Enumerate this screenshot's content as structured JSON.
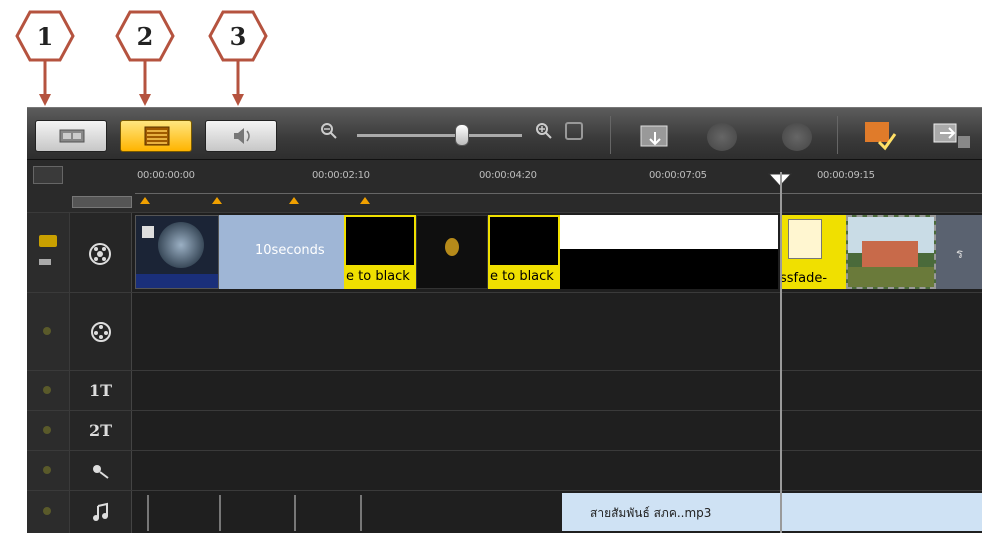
{
  "callouts": [
    "1",
    "2",
    "3"
  ],
  "view_buttons": {
    "storyboard": "storyboard-view-button",
    "timeline": "timeline-view-button",
    "audio": "audio-view-button"
  },
  "toolbar": {
    "zoom_out_icon": "zoom-out-icon",
    "zoom_in_icon": "zoom-in-icon",
    "fit_icon": "fit-to-window-icon",
    "insert_media_icon": "insert-media-icon",
    "undo_icon": "undo-icon",
    "redo_icon": "redo-icon",
    "smartrender_icon": "smart-render-icon",
    "export_icon": "export-icon"
  },
  "ruler": {
    "timecodes": [
      "00:00:00:00",
      "00:00:02:10",
      "00:00:04:20",
      "00:00:07:05",
      "00:00:09:15"
    ]
  },
  "video_track": {
    "clips": [
      {
        "label": "",
        "type": "thumb"
      },
      {
        "label": "10seconds",
        "type": "color"
      },
      {
        "label": "e to black",
        "type": "transition"
      },
      {
        "label": "",
        "type": "thumb-dark"
      },
      {
        "label": "e to black",
        "type": "transition"
      },
      {
        "label": "",
        "type": "white-black"
      },
      {
        "label": "ssfade-",
        "type": "transition"
      },
      {
        "label": "",
        "type": "photo"
      },
      {
        "label": "ร",
        "type": "grey"
      }
    ]
  },
  "tracks": {
    "overlay_icon": "overlay-track-icon",
    "title1_label": "1T",
    "title2_label": "2T",
    "voice_icon": "voice-track-icon",
    "music_icon": "music-track-icon"
  },
  "audio_clip": {
    "label": "สายสัมพันธ์ สภค..mp3"
  }
}
